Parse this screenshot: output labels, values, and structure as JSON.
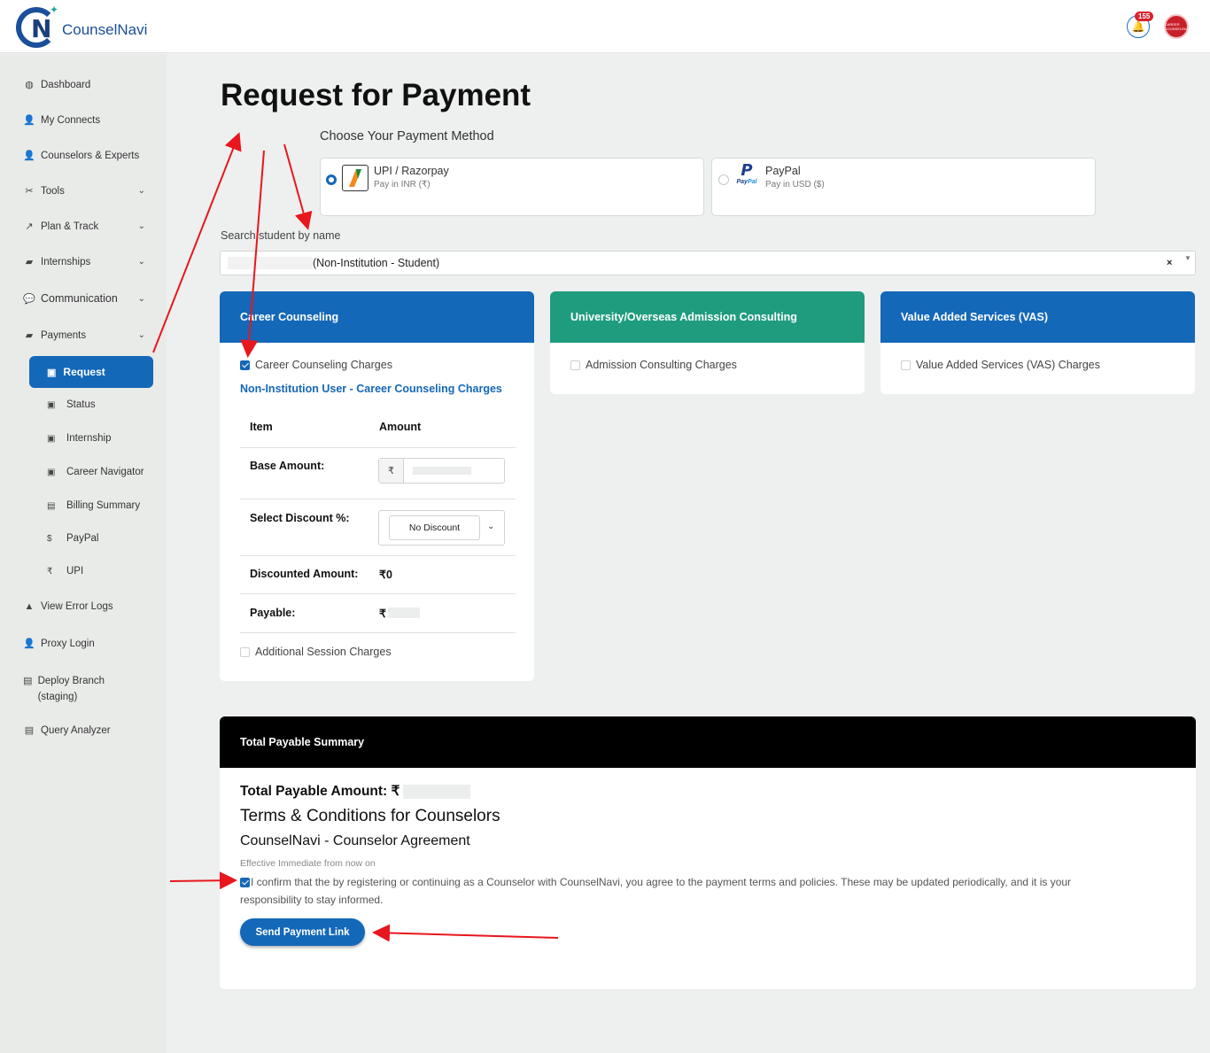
{
  "app": {
    "name": "CounselNavi",
    "notifications": "155",
    "avatar_text": "CAREER COUNSELING"
  },
  "sidebar": {
    "dashboard": "Dashboard",
    "my_connects": "My Connects",
    "counselors": "Counselors & Experts",
    "tools": "Tools",
    "plan_track": "Plan & Track",
    "internships": "Internships",
    "communication": "Communication",
    "payments": "Payments",
    "request": "Request",
    "status": "Status",
    "internship": "Internship",
    "career_navigator": "Career Navigator",
    "billing_summary": "Billing Summary",
    "paypal": "PayPal",
    "upi": "UPI",
    "view_error_logs": "View Error Logs",
    "proxy_login": "Proxy Login",
    "deploy_branch": "Deploy Branch (staging)",
    "query_analyzer": "Query Analyzer"
  },
  "page": {
    "title": "Request for Payment",
    "choose_method": "Choose Your Payment Method",
    "methods": [
      {
        "name": "UPI / Razorpay",
        "sub": "Pay in INR (₹)",
        "selected": true
      },
      {
        "name": "PayPal",
        "sub": "Pay in USD ($)",
        "selected": false
      }
    ],
    "search_label": "Search student by name",
    "search_value": "(Non-Institution - Student)",
    "search_clear": "×"
  },
  "services": {
    "career": {
      "title": "Career Counseling",
      "color": "#1468b8",
      "charge_label": "Career Counseling Charges",
      "charge_checked": true,
      "plan_link": "Non-Institution User - Career Counseling Charges",
      "col_item": "Item",
      "col_amount": "Amount",
      "base_label": "Base Amount:",
      "currency": "₹",
      "discount_label": "Select Discount %:",
      "discount_value": "No Discount",
      "discounted_label": "Discounted Amount:",
      "discounted_value": "₹0",
      "payable_label": "Payable:",
      "payable_currency": "₹",
      "additional_label": "Additional Session Charges"
    },
    "admission": {
      "title": "University/Overseas Admission Consulting",
      "color": "#1f9c7e",
      "charge_label": "Admission Consulting Charges"
    },
    "vas": {
      "title": "Value Added Services (VAS)",
      "color": "#1468b8",
      "charge_label": "Value Added Services (VAS) Charges"
    }
  },
  "summary": {
    "title": "Total Payable Summary",
    "total_label": "Total Payable Amount: ₹",
    "terms_title": "Terms & Conditions for Counselors",
    "agreement_title": "CounselNavi - Counselor Agreement",
    "effective": "Effective Immediate from now on",
    "confirm_text": "I confirm that the by registering or continuing as a Counselor with CounselNavi, you agree to the payment terms and policies. These may be updated periodically, and it is your responsibility to stay informed.",
    "send_button": "Send Payment Link"
  }
}
